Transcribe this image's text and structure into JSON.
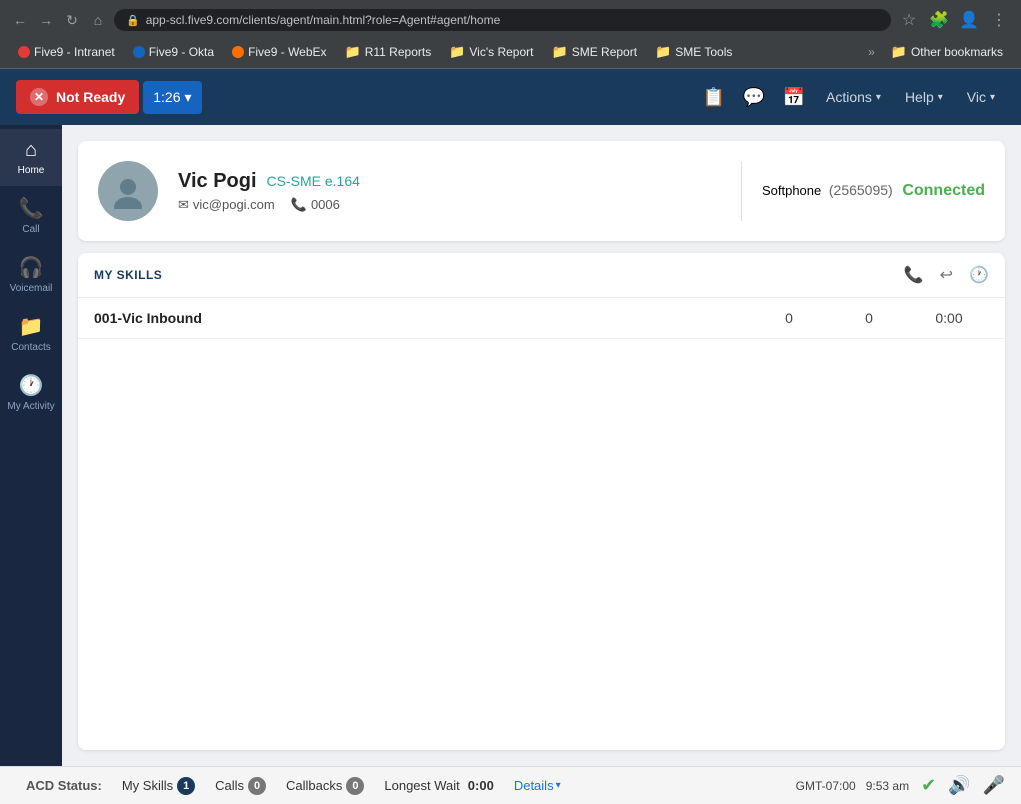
{
  "browser": {
    "url": "app-scl.five9.com/clients/agent/main.html?role=Agent#agent/home",
    "bookmarks": [
      {
        "id": "five9-intranet",
        "label": "Five9 - Intranet",
        "color": "#e53935",
        "type": "circle"
      },
      {
        "id": "five9-okta",
        "label": "Five9 - Okta",
        "color": "#1565c0",
        "type": "circle"
      },
      {
        "id": "five9-webex",
        "label": "Five9 - WebEx",
        "color": "#ff6f00",
        "type": "circle"
      },
      {
        "id": "r11-reports",
        "label": "R11 Reports",
        "color": "#fdd835",
        "type": "folder"
      },
      {
        "id": "vics-report",
        "label": "Vic's Report",
        "color": "#fdd835",
        "type": "folder"
      },
      {
        "id": "sme-report",
        "label": "SME Report",
        "color": "#fdd835",
        "type": "folder"
      },
      {
        "id": "sme-tools",
        "label": "SME Tools",
        "color": "#fdd835",
        "type": "folder"
      }
    ],
    "other_bookmarks": "Other bookmarks"
  },
  "header": {
    "not_ready_label": "Not Ready",
    "timer": "1:26",
    "timer_caret": "▾",
    "actions_label": "Actions",
    "actions_caret": "▾",
    "help_label": "Help",
    "help_caret": "▾",
    "user_label": "Vic",
    "user_caret": "▾"
  },
  "sidebar": {
    "items": [
      {
        "id": "home",
        "label": "Home",
        "icon": "⌂",
        "active": true
      },
      {
        "id": "call",
        "label": "Call",
        "icon": "📞",
        "active": false
      },
      {
        "id": "voicemail",
        "label": "Voicemail",
        "icon": "🎧",
        "active": false
      },
      {
        "id": "contacts",
        "label": "Contacts",
        "icon": "📁",
        "active": false
      },
      {
        "id": "my-activity",
        "label": "My Activity",
        "icon": "🕐",
        "active": false
      }
    ]
  },
  "profile": {
    "name": "Vic Pogi",
    "role": "CS-SME e.164",
    "email": "vic@pogi.com",
    "phone": "0006",
    "softphone_label": "Softphone",
    "softphone_number": "(2565095)",
    "softphone_status": "Connected"
  },
  "skills": {
    "title": "MY SKILLS",
    "columns": {
      "calls_icon": "📞",
      "callbacks_icon": "↩",
      "timer_icon": "🕐"
    },
    "rows": [
      {
        "name": "001-Vic Inbound",
        "calls": "0",
        "callbacks": "0",
        "time": "0:00"
      }
    ]
  },
  "status_bar": {
    "acd_label": "ACD Status:",
    "my_skills_label": "My Skills",
    "my_skills_count": "1",
    "calls_label": "Calls",
    "calls_count": "0",
    "callbacks_label": "Callbacks",
    "callbacks_count": "0",
    "longest_wait_label": "Longest Wait",
    "longest_wait_value": "0:00",
    "details_label": "Details",
    "details_caret": "▾",
    "timezone": "GMT-07:00",
    "time": "9:53 am"
  }
}
